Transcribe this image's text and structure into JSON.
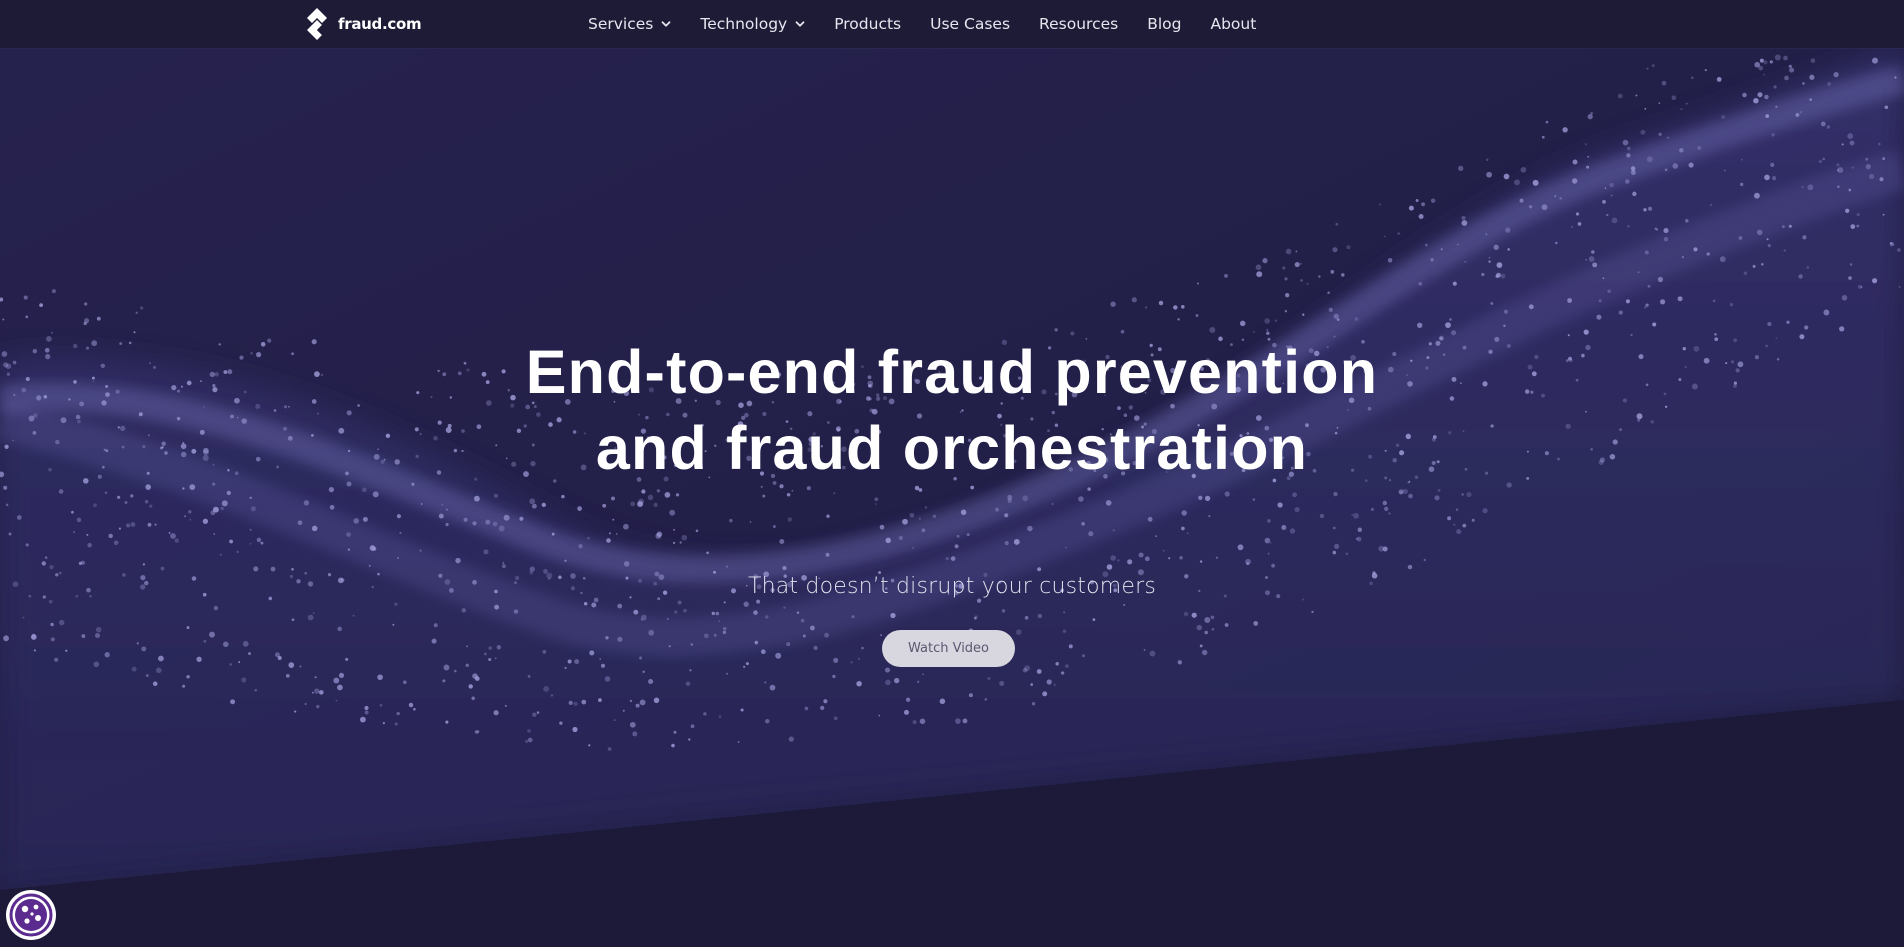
{
  "brand": {
    "name": "fraud.com",
    "logo_icon": "fraud-logo-mark"
  },
  "nav": {
    "items": [
      {
        "label": "Services",
        "dropdown": true
      },
      {
        "label": "Technology",
        "dropdown": true
      },
      {
        "label": "Products",
        "dropdown": false
      },
      {
        "label": "Use Cases",
        "dropdown": false
      },
      {
        "label": "Resources",
        "dropdown": false
      },
      {
        "label": "Blog",
        "dropdown": false
      },
      {
        "label": "About",
        "dropdown": false
      }
    ]
  },
  "hero": {
    "title_line1": "End-to-end fraud prevention",
    "title_line2": "and fraud orchestration",
    "subtitle": "That doesn’t disrupt your customers",
    "cta_label": "Watch Video"
  },
  "cookie": {
    "icon": "cookie-icon"
  },
  "colors": {
    "background": "#1c1a38",
    "navbar": "#1d1b36",
    "particles": "#8b89d0",
    "button": "#d8d7e0",
    "cookie_accent": "#5b2b8f"
  }
}
